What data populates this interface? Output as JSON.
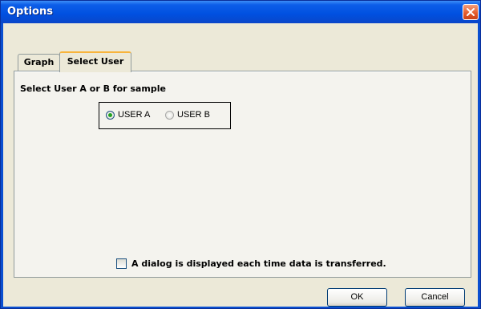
{
  "window": {
    "title": "Options"
  },
  "tabs": [
    {
      "label": "Graph",
      "active": false
    },
    {
      "label": "Select User",
      "active": true
    }
  ],
  "select_user": {
    "group_label": "Select User A or B for sample",
    "options": [
      {
        "label": "USER A",
        "selected": true
      },
      {
        "label": "USER B",
        "selected": false
      }
    ]
  },
  "checkbox": {
    "label": "A dialog is displayed  each time data is transferred.",
    "checked": false
  },
  "buttons": {
    "ok": "OK",
    "cancel": "Cancel"
  },
  "icons": {
    "close": "close-icon"
  },
  "colors": {
    "titlebar": "#0050e0",
    "close_button": "#e2592a",
    "dialog_background": "#ece9d8",
    "radio_selected_dot": "#21a121"
  }
}
